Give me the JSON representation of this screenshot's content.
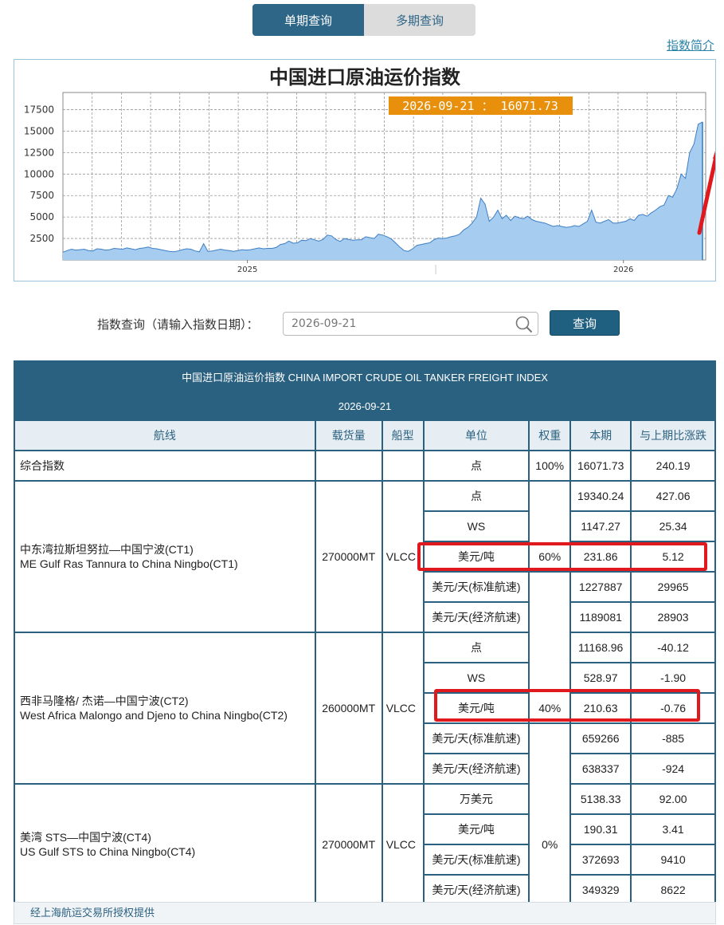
{
  "tabs": {
    "single": "单期查询",
    "multi": "多期查询"
  },
  "intro_link": "指数简介",
  "chart": {
    "title": "中国进口原油运价指数",
    "tooltip": "2026-09-21 ： 16071.73",
    "colors": {
      "fill": "#a6ccf0",
      "line": "#3d7fc4",
      "tooltip_bg": "#e8900c",
      "arrow": "#e0191f"
    }
  },
  "chart_data": {
    "type": "area",
    "title": "中国进口原油运价指数",
    "yticks": [
      2500,
      5000,
      7500,
      10000,
      12500,
      15000,
      17500
    ],
    "xtick_labels": [
      "2025",
      "2026"
    ],
    "ylim": [
      0,
      19500
    ],
    "series": [
      {
        "values": [
          900,
          1100,
          1250,
          1150,
          1200,
          1250,
          1100,
          1050,
          1300,
          1250,
          1150,
          1200,
          1350,
          1300,
          1250,
          1400,
          1300,
          1200,
          1350,
          1400,
          1500,
          1350,
          1300,
          1200,
          1100,
          1000,
          950,
          1050,
          1200,
          1300,
          1250,
          1050,
          950,
          1900,
          1000,
          1050,
          1150,
          1250,
          1150,
          1100,
          1000,
          1100,
          1200,
          1150,
          1200,
          1300,
          1400,
          1300,
          1350,
          1350,
          1450,
          1800,
          1900,
          2200,
          1950,
          2000,
          2300,
          2250,
          2500,
          2350,
          2200,
          2400,
          2900,
          2800,
          2400,
          2150,
          2500,
          2400,
          2300,
          2350,
          2350,
          2700,
          2600,
          2500,
          3000,
          2900,
          2700,
          2450,
          2000,
          1500,
          1100,
          1000,
          1300,
          1700,
          1800,
          1900,
          2000,
          2350,
          2550,
          2500,
          2550,
          2700,
          2800,
          3000,
          3500,
          3800,
          4300,
          5000,
          7200,
          6500,
          4500,
          5000,
          5800,
          4800,
          5200,
          4600,
          5100,
          4900,
          4800,
          5100,
          4700,
          4500,
          4400,
          4300,
          4100,
          3900,
          4000,
          3900,
          3800,
          3850,
          4000,
          3900,
          4200,
          4500,
          5800,
          4400,
          4300,
          4500,
          4700,
          4300,
          4300,
          4400,
          4500,
          4800,
          4600,
          5200,
          5300,
          5100,
          5500,
          5800,
          6200,
          6400,
          7500,
          7300,
          8300,
          10000,
          9500,
          12500,
          13500,
          15800,
          16071
        ]
      }
    ]
  },
  "query": {
    "label": "指数查询（请输入指数日期）：",
    "date": "2026-09-21",
    "button": "查询"
  },
  "table": {
    "title": "中国进口原油运价指数 CHINA IMPORT CRUDE OIL TANKER FREIGHT INDEX",
    "date": "2026-09-21",
    "headers": [
      "航线",
      "载货量",
      "船型",
      "单位",
      "权重",
      "本期",
      "与上期比涨跌"
    ],
    "composite": {
      "name": "综合指数",
      "unit": "点",
      "weight": "100%",
      "current": "16071.73",
      "change": "240.19"
    },
    "routes": [
      {
        "name_cn": "中东湾拉斯坦努拉—中国宁波(CT1)",
        "name_en": "ME Gulf Ras Tannura to China Ningbo(CT1)",
        "capacity": "270000MT",
        "ship": "VLCC",
        "rows": [
          {
            "unit": "点",
            "weight": "",
            "current": "19340.24",
            "change": "427.06"
          },
          {
            "unit": "WS",
            "weight": "",
            "current": "1147.27",
            "change": "25.34"
          },
          {
            "unit": "美元/吨",
            "weight": "60%",
            "current": "231.86",
            "change": "5.12"
          },
          {
            "unit": "美元/天(标准航速)",
            "weight": "",
            "current": "1227887",
            "change": "29965"
          },
          {
            "unit": "美元/天(经济航速)",
            "weight": "",
            "current": "1189081",
            "change": "28903"
          }
        ]
      },
      {
        "name_cn": "西非马隆格/ 杰诺—中国宁波(CT2)",
        "name_en": "West Africa Malongo and Djeno to China Ningbo(CT2)",
        "capacity": "260000MT",
        "ship": "VLCC",
        "rows": [
          {
            "unit": "点",
            "weight": "",
            "current": "11168.96",
            "change": "-40.12"
          },
          {
            "unit": "WS",
            "weight": "",
            "current": "528.97",
            "change": "-1.90"
          },
          {
            "unit": "美元/吨",
            "weight": "40%",
            "current": "210.63",
            "change": "-0.76"
          },
          {
            "unit": "美元/天(标准航速)",
            "weight": "",
            "current": "659266",
            "change": "-885"
          },
          {
            "unit": "美元/天(经济航速)",
            "weight": "",
            "current": "638337",
            "change": "-924"
          }
        ]
      },
      {
        "name_cn": "美湾 STS—中国宁波(CT4)",
        "name_en": "US Gulf STS to China Ningbo(CT4)",
        "capacity": "270000MT",
        "ship": "VLCC",
        "weight": "0%",
        "rows": [
          {
            "unit": "万美元",
            "weight": "",
            "current": "5138.33",
            "change": "92.00"
          },
          {
            "unit": "美元/吨",
            "weight": "",
            "current": "190.31",
            "change": "3.41"
          },
          {
            "unit": "美元/天(标准航速)",
            "weight": "",
            "current": "372693",
            "change": "9410"
          },
          {
            "unit": "美元/天(经济航速)",
            "weight": "",
            "current": "349329",
            "change": "8622"
          }
        ]
      }
    ]
  },
  "footer": "经上海航运交易所授权提供"
}
